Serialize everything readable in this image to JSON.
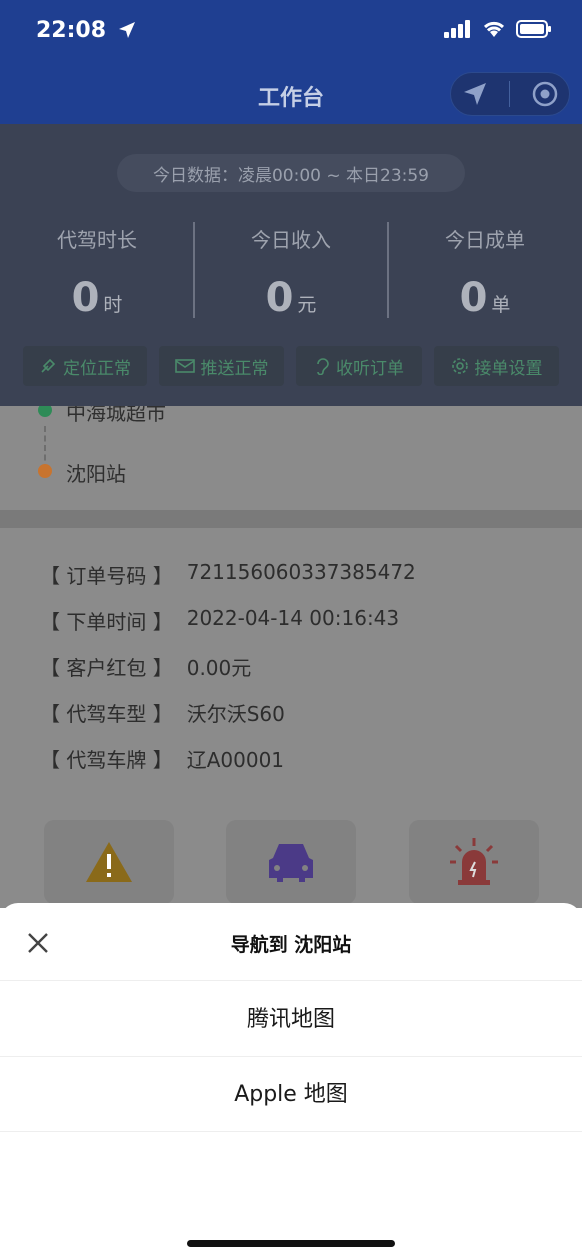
{
  "status_bar": {
    "time": "22:08"
  },
  "nav": {
    "title": "工作台"
  },
  "stats": {
    "range": "今日数据：凌晨00:00 ~ 本日23:59",
    "items": [
      {
        "label": "代驾时长",
        "value": "0",
        "unit": "时"
      },
      {
        "label": "今日收入",
        "value": "0",
        "unit": "元"
      },
      {
        "label": "今日成单",
        "value": "0",
        "unit": "单"
      }
    ],
    "chips": [
      "定位正常",
      "推送正常",
      "收听订单",
      "接单设置"
    ]
  },
  "route": {
    "from": "中海城超市",
    "to": "沈阳站",
    "from_color": "#2e8b57",
    "to_color": "#c8742f"
  },
  "order": {
    "rows": [
      {
        "label": "【 订单号码 】",
        "value": "721156060337385472"
      },
      {
        "label": "【 下单时间 】",
        "value": "2022-04-14 00:16:43"
      },
      {
        "label": "【 客户红包 】",
        "value": "0.00元"
      },
      {
        "label": "【 代驾车型 】",
        "value": "沃尔沃S60"
      },
      {
        "label": "【 代驾车牌 】",
        "value": "辽A00001"
      }
    ]
  },
  "sheet": {
    "title": "导航到 沈阳站",
    "options": [
      "腾讯地图",
      "Apple 地图"
    ]
  },
  "icons": {
    "status": [
      "location-arrow-icon",
      "signal-icon",
      "wifi-icon",
      "battery-icon"
    ],
    "capsule": [
      "navigate-icon",
      "target-icon"
    ],
    "actions": [
      "warning-icon",
      "car-icon",
      "alarm-icon"
    ],
    "close": "close-icon"
  }
}
